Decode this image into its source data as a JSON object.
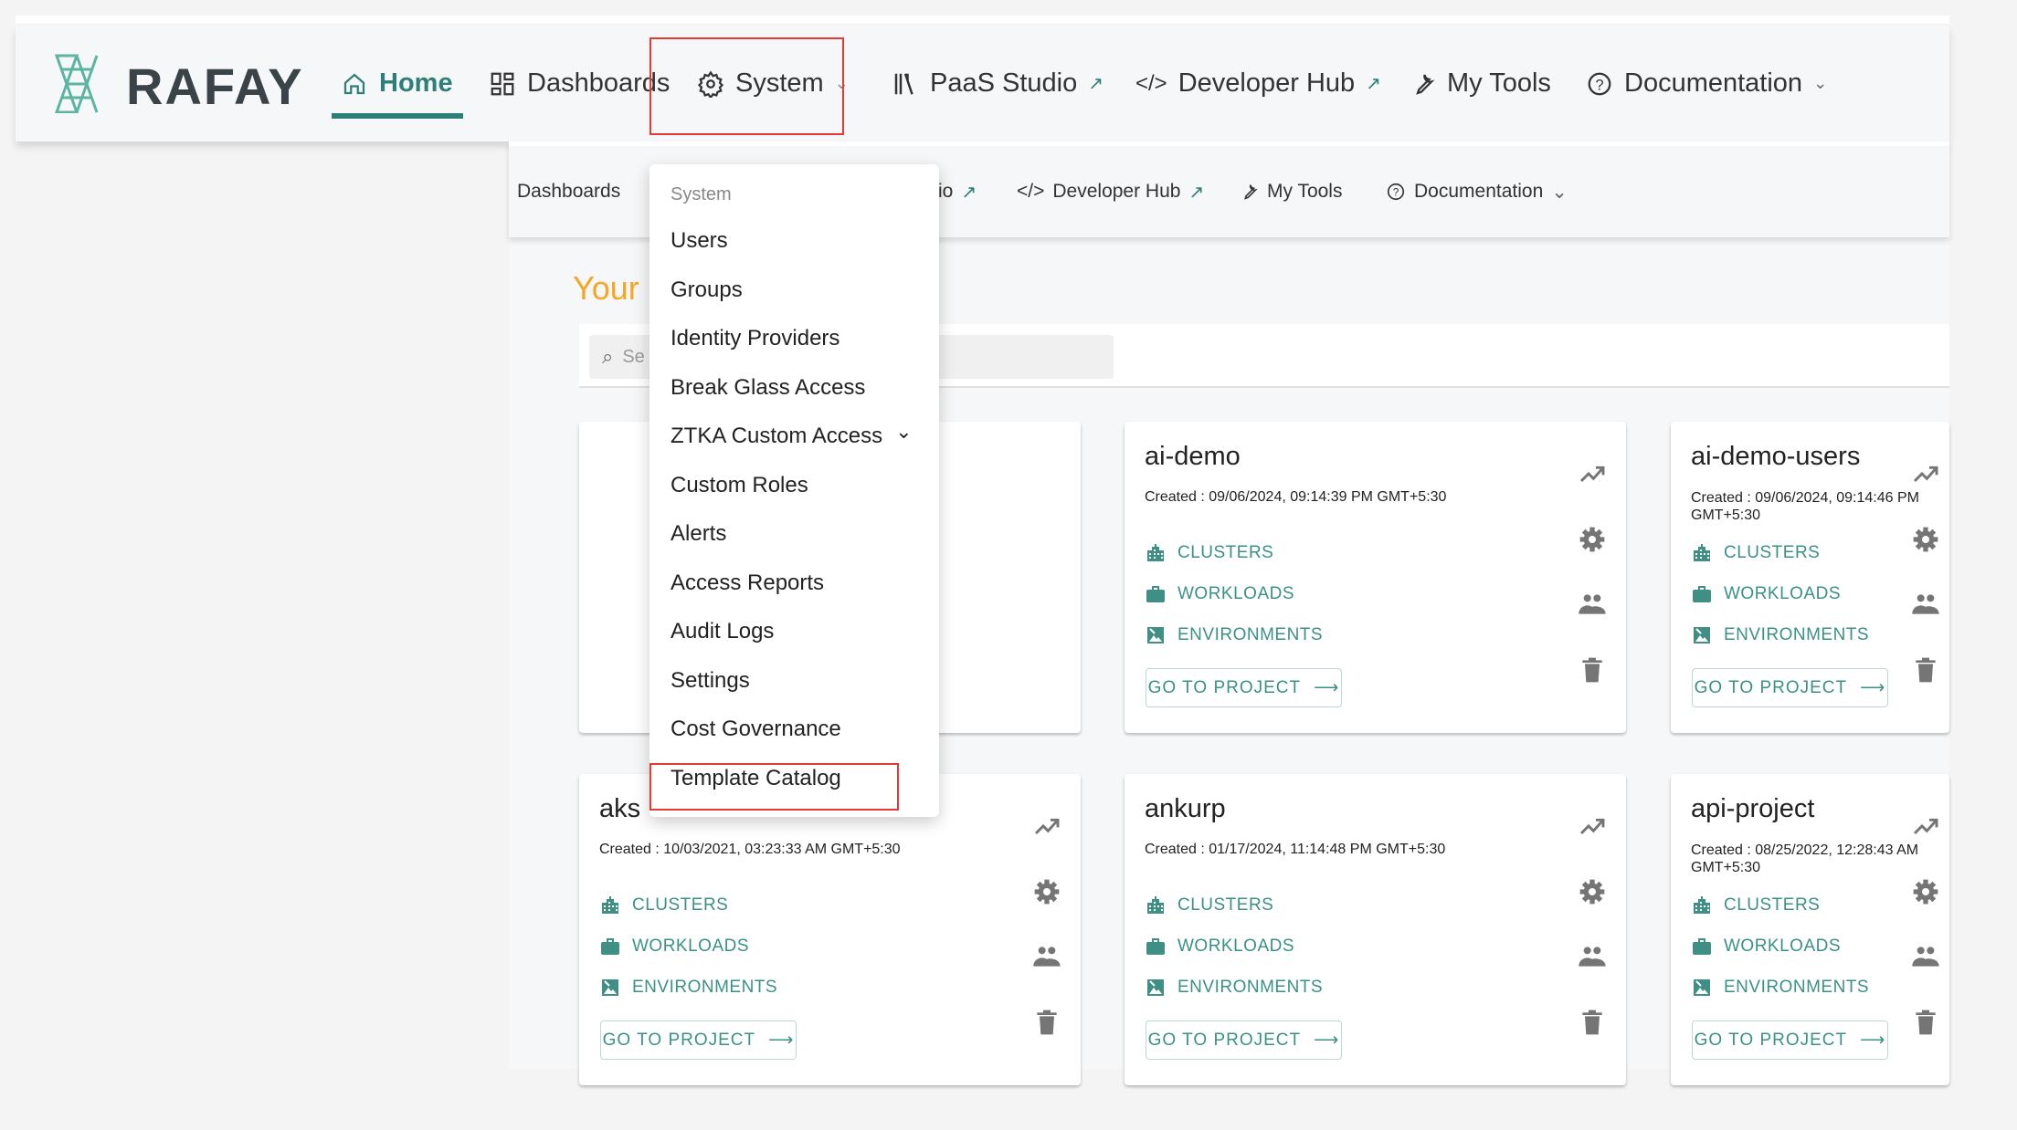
{
  "brand": {
    "name": "RAFAY",
    "accent": "#2f7f79",
    "link_color": "#3a9186",
    "highlight": "#f5a623"
  },
  "topnav": {
    "home": "Home",
    "dashboards": "Dashboards",
    "system": "System",
    "paas_studio": "PaaS Studio",
    "developer_hub": "Developer Hub",
    "my_tools": "My Tools",
    "documentation": "Documentation"
  },
  "subnav": {
    "dashboards": "Dashboards",
    "paas_studio_fragment": "io",
    "developer_hub": "Developer Hub",
    "my_tools": "My Tools",
    "documentation": "Documentation"
  },
  "main": {
    "heading_fragment": "Your",
    "search_placeholder_fragment": "Se"
  },
  "system_menu": {
    "header": "System",
    "items": [
      "Users",
      "Groups",
      "Identity Providers",
      "Break Glass Access",
      "ZTKA Custom Access",
      "Custom Roles",
      "Alerts",
      "Access Reports",
      "Audit Logs",
      "Settings",
      "Cost Governance",
      "Template Catalog"
    ]
  },
  "card_labels": {
    "clusters": "CLUSTERS",
    "workloads": "WORKLOADS",
    "environments": "ENVIRONMENTS",
    "go_to_project": "GO TO PROJECT"
  },
  "projects": [
    {
      "name": "",
      "created": ""
    },
    {
      "name": "ai-demo",
      "created": "Created : 09/06/2024, 09:14:39 PM GMT+5:30"
    },
    {
      "name": "ai-demo-users",
      "created": "Created : 09/06/2024, 09:14:46 PM GMT+5:30"
    },
    {
      "name": "aks",
      "created": "Created : 10/03/2021, 03:23:33 AM GMT+5:30"
    },
    {
      "name": "ankurp",
      "created": "Created : 01/17/2024, 11:14:48 PM GMT+5:30"
    },
    {
      "name": "api-project",
      "created": "Created : 08/25/2022, 12:28:43 AM GMT+5:30"
    }
  ]
}
